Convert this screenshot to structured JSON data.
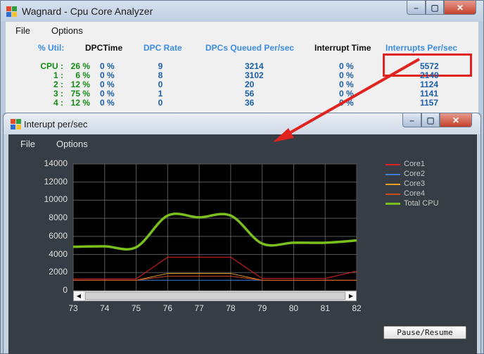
{
  "main_window": {
    "title": "Wagnard - Cpu Core Analyzer",
    "menu": [
      "File",
      "Options"
    ],
    "headers": {
      "util": "% Util:",
      "dpc_time": "DPCTime",
      "dpc_rate": "DPC Rate",
      "dpcs_queued": "DPCs Queued Per/sec",
      "interrupt_time": "Interrupt Time",
      "interrupts_per_sec": "Interrupts Per/sec"
    },
    "rows": [
      {
        "label": "CPU :",
        "util": "26 %",
        "dpc_time": "0 %",
        "dpc_rate": "9",
        "dpcs_queued": "3214",
        "interrupt_time": "0 %",
        "interrupts": "5572"
      },
      {
        "label": "1 :",
        "util": "6 %",
        "dpc_time": "0 %",
        "dpc_rate": "8",
        "dpcs_queued": "3102",
        "interrupt_time": "0 %",
        "interrupts": "2149"
      },
      {
        "label": "2 :",
        "util": "12 %",
        "dpc_time": "0 %",
        "dpc_rate": "0",
        "dpcs_queued": "20",
        "interrupt_time": "0 %",
        "interrupts": "1124"
      },
      {
        "label": "3 :",
        "util": "75 %",
        "dpc_time": "0 %",
        "dpc_rate": "1",
        "dpcs_queued": "56",
        "interrupt_time": "0 %",
        "interrupts": "1141"
      },
      {
        "label": "4 :",
        "util": "12 %",
        "dpc_time": "0 %",
        "dpc_rate": "0",
        "dpcs_queued": "36",
        "interrupt_time": "0 %",
        "interrupts": "1157"
      }
    ],
    "highlight_color": "#e0231f"
  },
  "chart_window": {
    "title": "Interupt per/sec",
    "menu": [
      "File",
      "Options"
    ],
    "pause_button": "Pause/Resume"
  },
  "chart_data": {
    "type": "line",
    "title": "",
    "xlabel": "",
    "ylabel": "",
    "x": [
      73,
      74,
      75,
      76,
      77,
      78,
      79,
      80,
      81,
      82
    ],
    "xlim": [
      73,
      82
    ],
    "ylim": [
      0,
      14000
    ],
    "yticks": [
      0,
      2000,
      4000,
      6000,
      8000,
      10000,
      12000,
      14000
    ],
    "xticks": [
      73,
      74,
      75,
      76,
      77,
      78,
      79,
      80,
      81,
      82
    ],
    "grid": true,
    "legend_position": "right",
    "series": [
      {
        "name": "Core1",
        "color": "#e02020",
        "values": [
          1300,
          1300,
          1300,
          3700,
          3700,
          3700,
          1350,
          1350,
          1350,
          2150
        ],
        "smooth": false
      },
      {
        "name": "Core2",
        "color": "#3a7ee0",
        "values": [
          1150,
          1150,
          1150,
          1150,
          1150,
          1150,
          1150,
          1150,
          1150,
          1150
        ],
        "smooth": false
      },
      {
        "name": "Core3",
        "color": "#f0a020",
        "values": [
          1150,
          1150,
          1150,
          1900,
          1900,
          1900,
          1150,
          1150,
          1150,
          1150
        ],
        "smooth": false
      },
      {
        "name": "Core4",
        "color": "#d04818",
        "values": [
          1150,
          1150,
          1150,
          1600,
          1600,
          1600,
          1150,
          1150,
          1150,
          1150
        ],
        "smooth": false
      },
      {
        "name": "Total CPU",
        "color": "#7bbf1e",
        "values": [
          4850,
          4900,
          4800,
          8300,
          8100,
          8300,
          5200,
          5300,
          5300,
          5550
        ],
        "smooth": true
      }
    ]
  }
}
